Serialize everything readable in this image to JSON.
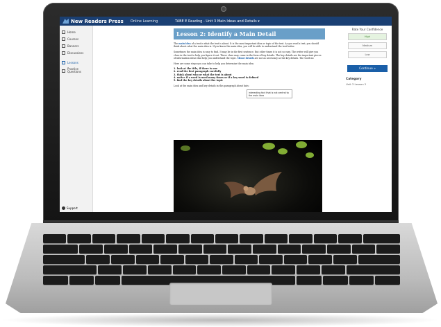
{
  "app": {
    "brand": "New Readers Press",
    "section": "Online Learning",
    "nav_title": "TABE E Reading - Unit 3 Main Ideas and Details ▾"
  },
  "sidebar": {
    "items": [
      {
        "label": "Home",
        "icon": "home-icon"
      },
      {
        "label": "Courses",
        "icon": "courses-icon"
      },
      {
        "label": "Banners",
        "icon": "banners-icon"
      },
      {
        "label": "Discussions",
        "icon": "discussions-icon"
      },
      {
        "label": "Lessons",
        "icon": "lessons-icon"
      },
      {
        "label": "Practice Questions",
        "icon": "questions-icon"
      }
    ],
    "support": "Support"
  },
  "lesson": {
    "title": "Lesson 2: Identify a Main Detail",
    "p1_lead": "The",
    "p1_link": "main idea",
    "p1_rest": "of a text is what the text is about. It is the most important idea or topic of the text. As you read a text, you should think about what the main idea is. If you know the main idea, you will be able to understand the text better.",
    "p2_a": "Sometimes the main idea is easy to find. It may be in the first sentence. But other times it is not so easy. The writer will give you clues in the text to help you figure it out. These clues may come in the form of key details. The key details are the important pieces of information",
    "p2_b": "ideas that help you understand the topic.",
    "p2_link": "Minor details",
    "p2_c": "are not as necessary as the key details. The word mi",
    "p3": "Here are some steps you can take to help you determine the main idea:",
    "steps": [
      "1. look at the title, if there is one",
      "2. read the first paragraph carefully",
      "3. think about who or what the text is about",
      "4. notice if a word is used many times or if a key word is defined",
      "5. find the key details about the topic"
    ],
    "p4": "Look at the main idea and key details in this paragraph about bats:",
    "tooltip": "interesting fact that is not central to the main idea"
  },
  "confidence": {
    "title": "Rate Your Confidence",
    "options": [
      "High",
      "Medium",
      "Low"
    ],
    "continue": "Continue »"
  },
  "category": {
    "heading": "Category",
    "value": "Unit 3 Lesson 2"
  }
}
